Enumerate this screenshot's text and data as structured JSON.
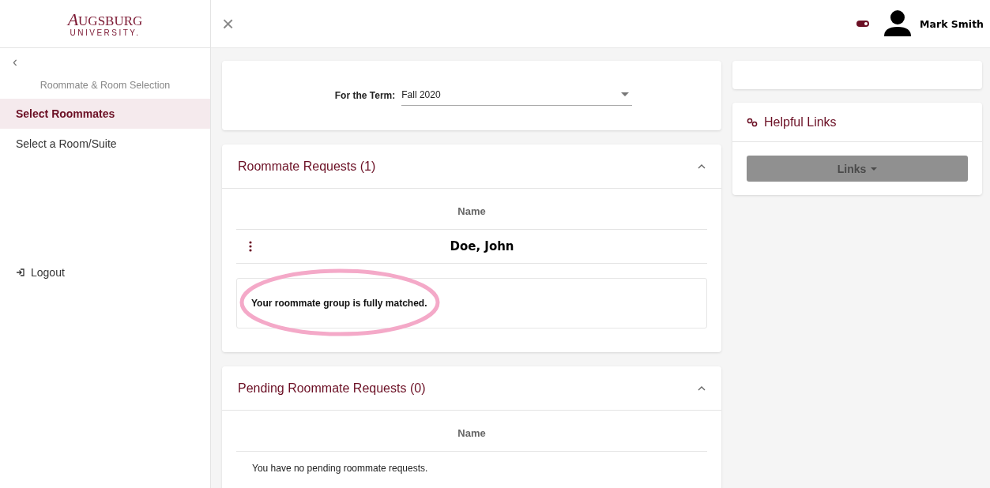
{
  "logo": {
    "name": "AUGSBURG",
    "sub": "UNIVERSITY."
  },
  "topbar": {
    "close": "×",
    "theme_toggle_on": true,
    "user": "Mark Smith"
  },
  "sidebar": {
    "back": "‹",
    "section": "Roommate & Room Selection",
    "items": [
      {
        "label": "Select Roommates",
        "selected": true
      },
      {
        "label": "Select a Room/Suite",
        "selected": false
      }
    ],
    "logout": "Logout"
  },
  "term": {
    "label": "For the Term:",
    "value": "Fall 2020"
  },
  "roommate_requests": {
    "title": "Roommate Requests (1)",
    "expanded": true,
    "column": "Name",
    "rows": [
      {
        "name": "Doe, John"
      }
    ],
    "message": "Your roommate group is fully matched.",
    "highlighted": true
  },
  "pending_requests": {
    "title": "Pending Roommate Requests (0)",
    "expanded": true,
    "column": "Name",
    "empty": "You have no pending roommate requests."
  },
  "helpful_links": {
    "title": "Helpful Links",
    "button": "Links",
    "disabled": true
  }
}
